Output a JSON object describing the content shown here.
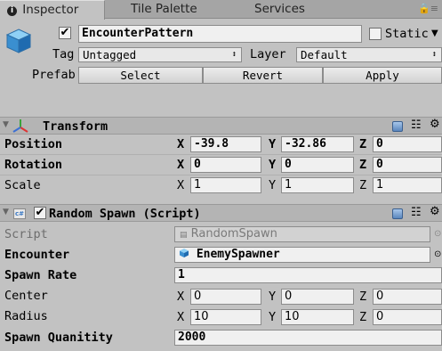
{
  "tabs": [
    {
      "label": "Inspector",
      "active": true
    },
    {
      "label": "Tile Palette",
      "active": false
    },
    {
      "label": "Services",
      "active": false
    }
  ],
  "tab_menu": "▲ ≡",
  "gameobject": {
    "name": "EncounterPattern",
    "active": true,
    "static_label": "Static",
    "static_checked": false,
    "tag_label": "Tag",
    "tag_value": "Untagged",
    "layer_label": "Layer",
    "layer_value": "Default"
  },
  "prefab": {
    "label": "Prefab",
    "select": "Select",
    "revert": "Revert",
    "apply": "Apply"
  },
  "transform": {
    "title": "Transform",
    "position_label": "Position",
    "rotation_label": "Rotation",
    "scale_label": "Scale",
    "position": {
      "x": "-39.8",
      "y": "-32.86",
      "z": "0"
    },
    "rotation": {
      "x": "0",
      "y": "0",
      "z": "0"
    },
    "scale": {
      "x": "1",
      "y": "1",
      "z": "1"
    }
  },
  "random_spawn": {
    "title": "Random Spawn (Script)",
    "enabled": true,
    "script_label": "Script",
    "script_value": "RandomSpawn",
    "encounter_label": "Encounter",
    "encounter_value": "EnemySpawner",
    "spawn_rate_label": "Spawn Rate",
    "spawn_rate_value": "1",
    "center_label": "Center",
    "center": {
      "x": "0",
      "y": "0",
      "z": "0"
    },
    "radius_label": "Radius",
    "radius": {
      "x": "10",
      "y": "10",
      "z": "0"
    },
    "spawn_quantity_label": "Spawn Quanitity",
    "spawn_quantity_value": "2000"
  },
  "axis": {
    "x": "X",
    "y": "Y",
    "z": "Z"
  },
  "colors": {
    "panel": "#c2c2c2",
    "tabbar": "#a5a5a5",
    "section_header": "#b4b4b4",
    "field": "#f0f0f0",
    "accent_blue": "#3b79c4"
  }
}
